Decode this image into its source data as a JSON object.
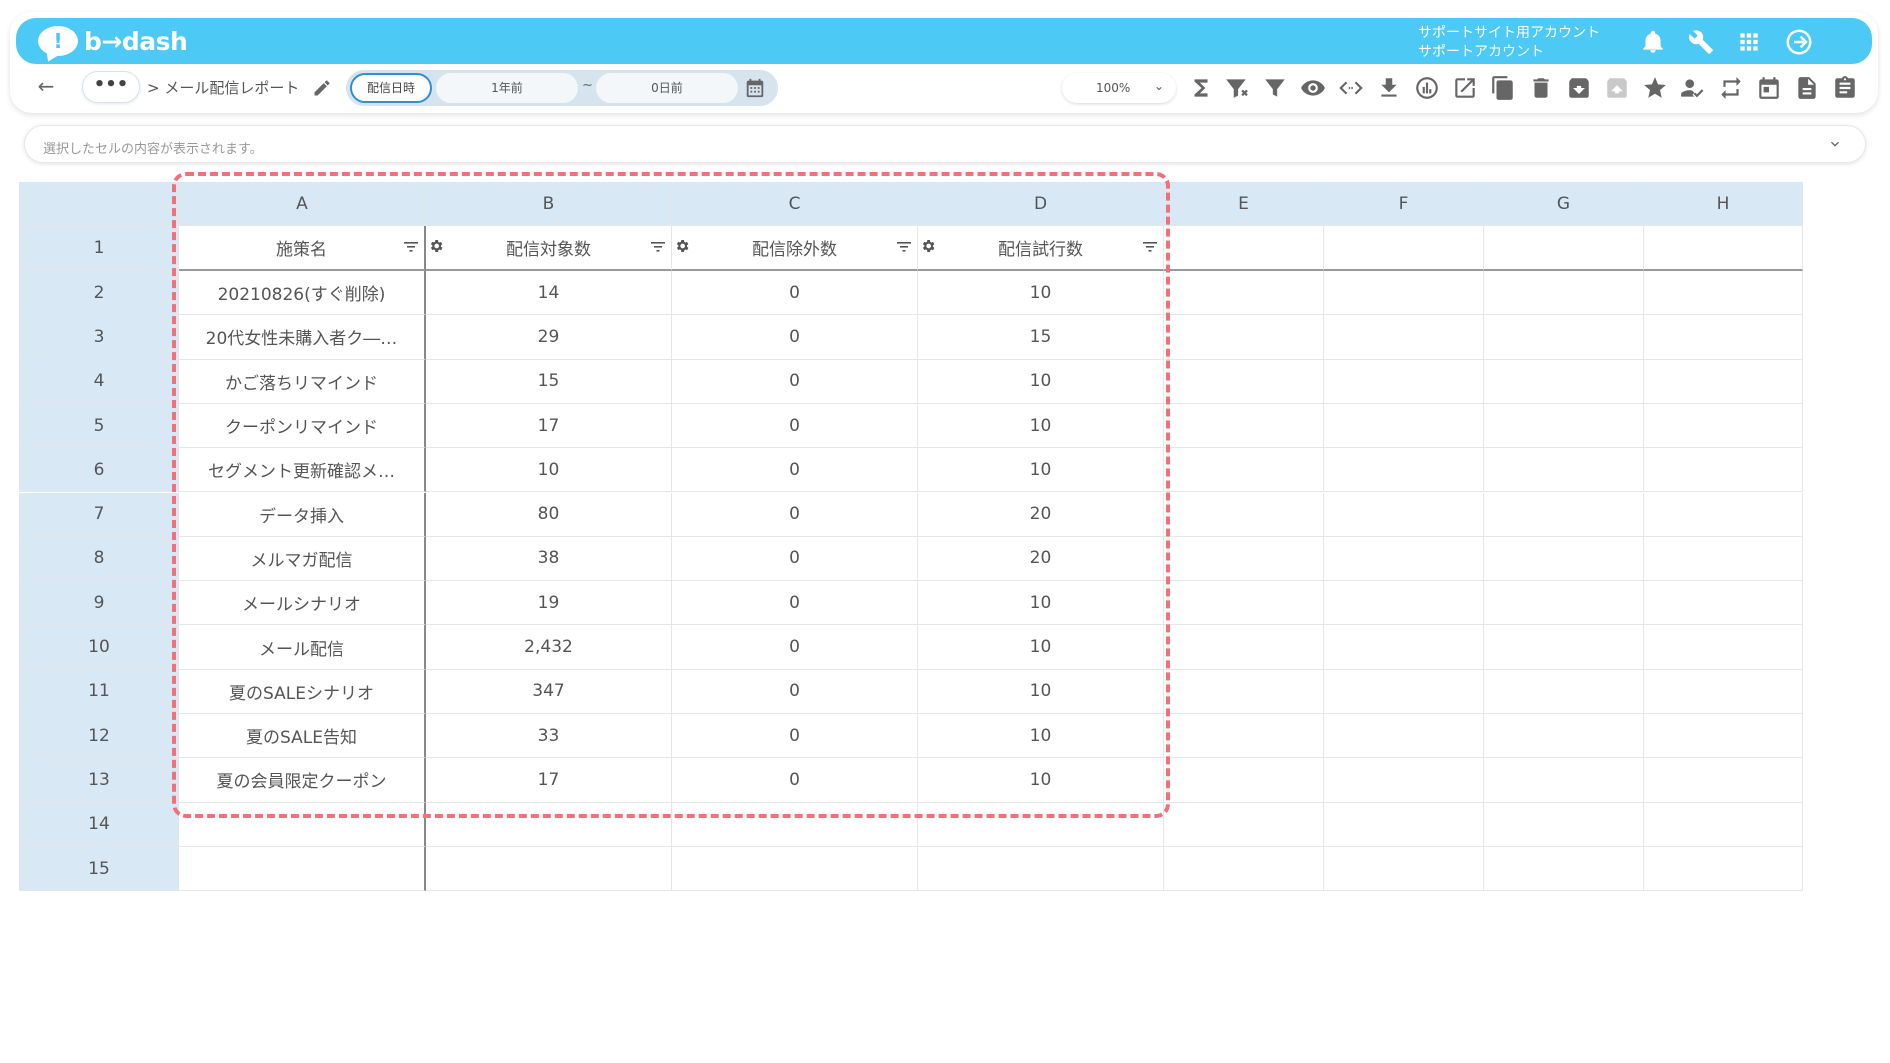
{
  "app": {
    "logo_text": "b→dash",
    "logo_mark": "!"
  },
  "account": {
    "line1": "サポートサイト用アカウント",
    "line2": "サポートアカウント"
  },
  "toolbar": {
    "back_label": "←",
    "more_label": "•••",
    "breadcrumb": "> メール配信レポート",
    "date_mode": "配信日時",
    "date_from": "1年前",
    "date_sep": "~",
    "date_to": "0日前",
    "zoom": "100%"
  },
  "formula_bar": {
    "placeholder": "選択したセルの内容が表示されます。"
  },
  "grid": {
    "columns": [
      "A",
      "B",
      "C",
      "D",
      "E",
      "F",
      "G",
      "H"
    ],
    "header_row": {
      "row_label": "1",
      "fields": [
        "施策名",
        "配信対象数",
        "配信除外数",
        "配信試行数"
      ]
    },
    "rows": [
      {
        "num": "2",
        "cells": [
          "20210826(すぐ削除)",
          "14",
          "0",
          "10"
        ]
      },
      {
        "num": "3",
        "cells": [
          "20代女性未購入者ク―…",
          "29",
          "0",
          "15"
        ]
      },
      {
        "num": "4",
        "cells": [
          "かご落ちリマインド",
          "15",
          "0",
          "10"
        ]
      },
      {
        "num": "5",
        "cells": [
          "クーポンリマインド",
          "17",
          "0",
          "10"
        ]
      },
      {
        "num": "6",
        "cells": [
          "セグメント更新確認メ…",
          "10",
          "0",
          "10"
        ]
      },
      {
        "num": "7",
        "cells": [
          "データ挿入",
          "80",
          "0",
          "20"
        ]
      },
      {
        "num": "8",
        "cells": [
          "メルマガ配信",
          "38",
          "0",
          "20"
        ]
      },
      {
        "num": "9",
        "cells": [
          "メールシナリオ",
          "19",
          "0",
          "10"
        ]
      },
      {
        "num": "10",
        "cells": [
          "メール配信",
          "2,432",
          "0",
          "10"
        ]
      },
      {
        "num": "11",
        "cells": [
          "夏のSALEシナリオ",
          "347",
          "0",
          "10"
        ]
      },
      {
        "num": "12",
        "cells": [
          "夏のSALE告知",
          "33",
          "0",
          "10"
        ]
      },
      {
        "num": "13",
        "cells": [
          "夏の会員限定クーポン",
          "17",
          "0",
          "10"
        ]
      },
      {
        "num": "14",
        "cells": [
          "",
          "",
          "",
          ""
        ]
      },
      {
        "num": "15",
        "cells": [
          "",
          "",
          "",
          ""
        ]
      }
    ]
  },
  "colors": {
    "header_bar": "#4cc9f5",
    "grid_header": "#d9e8f5",
    "highlight": "#f1707a",
    "active_border": "#2e8fd6"
  },
  "icons": [
    "bell-icon",
    "wrench-icon",
    "apps-grid-icon",
    "logout-icon",
    "sum-icon",
    "filter-clear-icon",
    "filter-icon",
    "eye-icon",
    "code-icon",
    "download-icon",
    "chart-icon",
    "edit-note-icon",
    "copy-icon",
    "trash-icon",
    "archive-icon",
    "unarchive-icon",
    "star-icon",
    "user-check-icon",
    "sync-icon",
    "calendar-icon",
    "document-icon",
    "clipboard-icon"
  ]
}
